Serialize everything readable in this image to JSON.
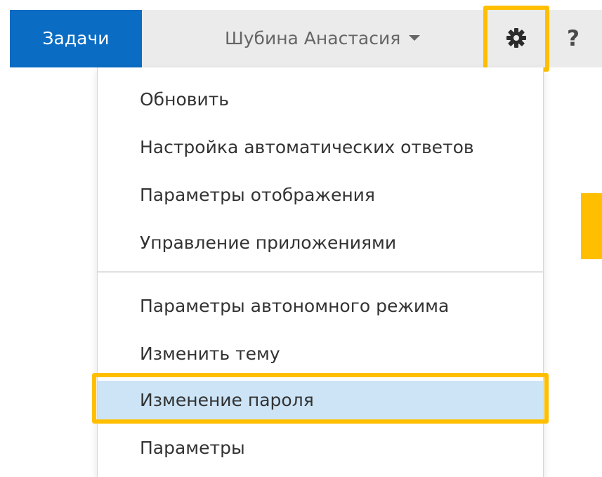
{
  "colors": {
    "accent_blue": "#0a6cc2",
    "topbar_gray": "#ebebeb",
    "highlight_yellow": "#ffbf00",
    "selected_item": "#cce4f6"
  },
  "header": {
    "tab_label": "Задачи",
    "user_name": "Шубина Анастасия",
    "user_menu_icon": "chevron-down-icon",
    "settings_icon": "gear-icon",
    "help_label": "?"
  },
  "menu": {
    "group1": [
      {
        "label": "Обновить"
      },
      {
        "label": "Настройка автоматических ответов"
      },
      {
        "label": "Параметры отображения"
      },
      {
        "label": "Управление приложениями"
      }
    ],
    "group2": [
      {
        "label": "Параметры автономного режима"
      },
      {
        "label": "Изменить тему"
      },
      {
        "label": "Изменение пароля",
        "selected": true
      },
      {
        "label": "Параметры"
      }
    ]
  }
}
